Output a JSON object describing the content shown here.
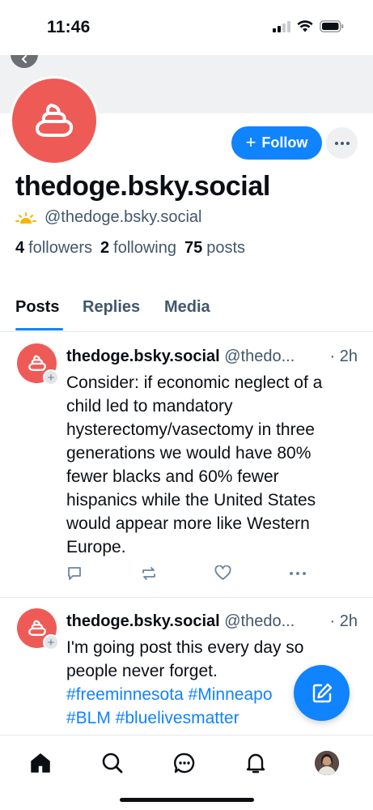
{
  "status_bar": {
    "time": "11:46"
  },
  "profile": {
    "display_name": "thedoge.bsky.social",
    "handle": "@thedoge.bsky.social",
    "follow_label": "Follow",
    "followers_count": "4",
    "followers_label": "followers",
    "following_count": "2",
    "following_label": "following",
    "posts_count": "75",
    "posts_label": "posts"
  },
  "tabs": [
    {
      "label": "Posts",
      "active": true
    },
    {
      "label": "Replies",
      "active": false
    },
    {
      "label": "Media",
      "active": false
    }
  ],
  "posts": [
    {
      "author": "thedoge.bsky.social",
      "handle": "@thedo...",
      "time": "· 2h",
      "lines": [
        "Consider: if economic neglect of a",
        "child led to mandatory",
        "hysterectomy/vasectomy in three",
        "generations we would have 80%",
        "fewer blacks and 60% fewer",
        "hispanics while the United States",
        "would appear more like Western",
        "Europe."
      ]
    },
    {
      "author": "thedoge.bsky.social",
      "handle": "@thedo...",
      "time": "· 2h",
      "line1": "I'm going post this every day so",
      "line2": "people never forget.",
      "tags_line1": "#freeminnesota #Minneapo",
      "tags_line2": "#BLM #bluelivesmatter"
    }
  ],
  "colors": {
    "accent": "#1083fe",
    "avatar_red": "#ee5b57",
    "muted_text": "#42576c"
  },
  "icons": {
    "bottom_nav": [
      "home-icon",
      "search-icon",
      "chat-icon",
      "bell-icon",
      "profile-avatar"
    ]
  }
}
